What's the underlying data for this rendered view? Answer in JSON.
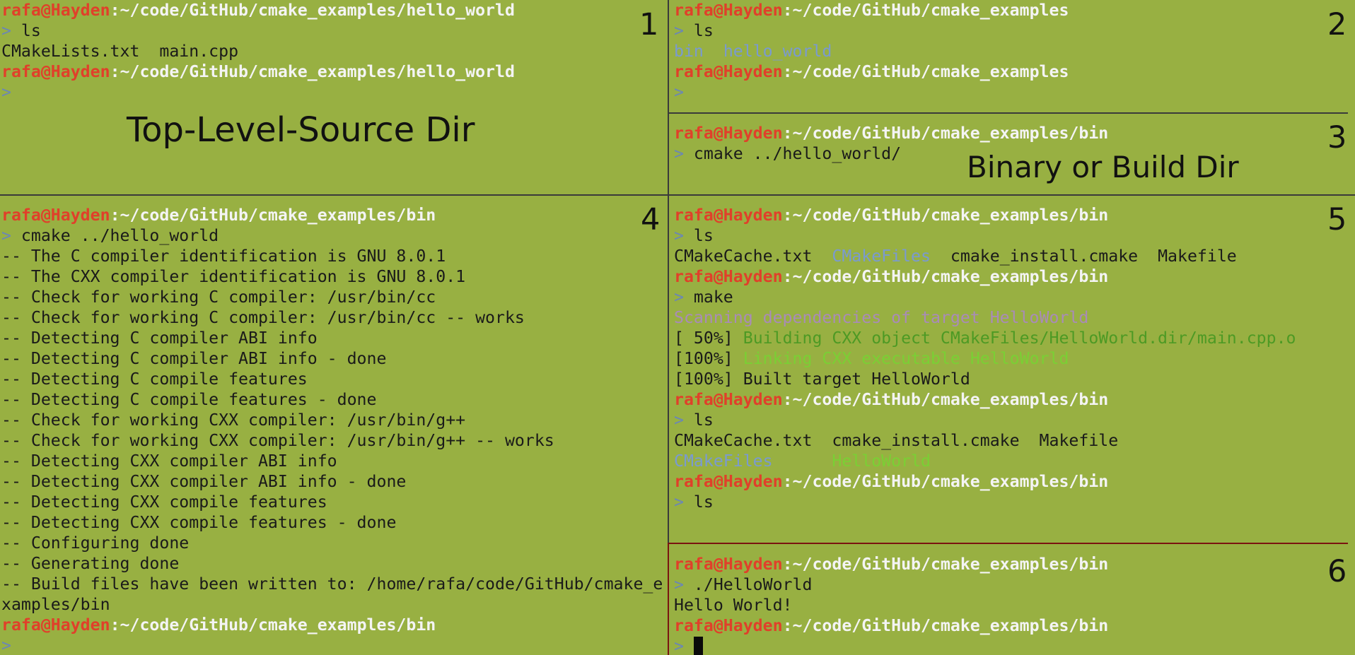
{
  "pane1": {
    "number": "1",
    "annotation": "Top-Level-Source Dir",
    "lines": [
      [
        {
          "t": "rafa@Hayden",
          "c": "u"
        },
        {
          "t": ":~/code/GitHub/cmake_examples/hello_world",
          "c": "p"
        }
      ],
      [
        {
          "t": "> ",
          "c": "pr"
        },
        {
          "t": "ls",
          "c": "o"
        }
      ],
      [
        {
          "t": "CMakeLists.txt  main.cpp",
          "c": "o"
        }
      ],
      [
        {
          "t": "rafa@Hayden",
          "c": "u"
        },
        {
          "t": ":~/code/GitHub/cmake_examples/hello_world",
          "c": "p"
        }
      ],
      [
        {
          "t": ">",
          "c": "pr"
        }
      ]
    ]
  },
  "pane2": {
    "number": "2",
    "lines": [
      [
        {
          "t": "rafa@Hayden",
          "c": "u"
        },
        {
          "t": ":~/code/GitHub/cmake_examples",
          "c": "p"
        }
      ],
      [
        {
          "t": "> ",
          "c": "pr"
        },
        {
          "t": "ls",
          "c": "o"
        }
      ],
      [
        {
          "t": "bin",
          "c": "dir"
        },
        {
          "t": "  ",
          "c": "o"
        },
        {
          "t": "hello_world",
          "c": "dir"
        }
      ],
      [
        {
          "t": "rafa@Hayden",
          "c": "u"
        },
        {
          "t": ":~/code/GitHub/cmake_examples",
          "c": "p"
        }
      ],
      [
        {
          "t": ">",
          "c": "pr"
        }
      ]
    ]
  },
  "pane3": {
    "number": "3",
    "annotation": "Binary or Build Dir",
    "lines": [
      [
        {
          "t": "rafa@Hayden",
          "c": "u"
        },
        {
          "t": ":~/code/GitHub/cmake_examples/bin",
          "c": "p"
        }
      ],
      [
        {
          "t": "> ",
          "c": "pr"
        },
        {
          "t": "cmake ../hello_world/",
          "c": "o"
        }
      ]
    ]
  },
  "pane4": {
    "number": "4",
    "lines": [
      [
        {
          "t": "rafa@Hayden",
          "c": "u"
        },
        {
          "t": ":~/code/GitHub/cmake_examples/bin",
          "c": "p"
        }
      ],
      [
        {
          "t": "> ",
          "c": "pr"
        },
        {
          "t": "cmake ../hello_world",
          "c": "o"
        }
      ],
      [
        {
          "t": "-- The C compiler identification is GNU 8.0.1",
          "c": "o"
        }
      ],
      [
        {
          "t": "-- The CXX compiler identification is GNU 8.0.1",
          "c": "o"
        }
      ],
      [
        {
          "t": "-- Check for working C compiler: /usr/bin/cc",
          "c": "o"
        }
      ],
      [
        {
          "t": "-- Check for working C compiler: /usr/bin/cc -- works",
          "c": "o"
        }
      ],
      [
        {
          "t": "-- Detecting C compiler ABI info",
          "c": "o"
        }
      ],
      [
        {
          "t": "-- Detecting C compiler ABI info - done",
          "c": "o"
        }
      ],
      [
        {
          "t": "-- Detecting C compile features",
          "c": "o"
        }
      ],
      [
        {
          "t": "-- Detecting C compile features - done",
          "c": "o"
        }
      ],
      [
        {
          "t": "-- Check for working CXX compiler: /usr/bin/g++",
          "c": "o"
        }
      ],
      [
        {
          "t": "-- Check for working CXX compiler: /usr/bin/g++ -- works",
          "c": "o"
        }
      ],
      [
        {
          "t": "-- Detecting CXX compiler ABI info",
          "c": "o"
        }
      ],
      [
        {
          "t": "-- Detecting CXX compiler ABI info - done",
          "c": "o"
        }
      ],
      [
        {
          "t": "-- Detecting CXX compile features",
          "c": "o"
        }
      ],
      [
        {
          "t": "-- Detecting CXX compile features - done",
          "c": "o"
        }
      ],
      [
        {
          "t": "-- Configuring done",
          "c": "o"
        }
      ],
      [
        {
          "t": "-- Generating done",
          "c": "o"
        }
      ],
      [
        {
          "t": "-- Build files have been written to: /home/rafa/code/GitHub/cmake_e",
          "c": "o"
        }
      ],
      [
        {
          "t": "xamples/bin",
          "c": "o"
        }
      ],
      [
        {
          "t": "rafa@Hayden",
          "c": "u"
        },
        {
          "t": ":~/code/GitHub/cmake_examples/bin",
          "c": "p"
        }
      ],
      [
        {
          "t": ">",
          "c": "pr"
        }
      ]
    ]
  },
  "pane5": {
    "number": "5",
    "lines": [
      [
        {
          "t": "rafa@Hayden",
          "c": "u"
        },
        {
          "t": ":~/code/GitHub/cmake_examples/bin",
          "c": "p"
        }
      ],
      [
        {
          "t": "> ",
          "c": "pr"
        },
        {
          "t": "ls",
          "c": "o"
        }
      ],
      [
        {
          "t": "CMakeCache.txt  ",
          "c": "o"
        },
        {
          "t": "CMakeFiles",
          "c": "dir"
        },
        {
          "t": "  cmake_install.cmake  Makefile",
          "c": "o"
        }
      ],
      [
        {
          "t": "rafa@Hayden",
          "c": "u"
        },
        {
          "t": ":~/code/GitHub/cmake_examples/bin",
          "c": "p"
        }
      ],
      [
        {
          "t": "> ",
          "c": "pr"
        },
        {
          "t": "make",
          "c": "o"
        }
      ],
      [
        {
          "t": "Scanning dependencies of target HelloWorld",
          "c": "mg"
        }
      ],
      [
        {
          "t": "[ 50%] ",
          "c": "o"
        },
        {
          "t": "Building CXX object CMakeFiles/HelloWorld.dir/main.cpp.o",
          "c": "gr"
        }
      ],
      [
        {
          "t": "[100%] ",
          "c": "o"
        },
        {
          "t": "Linking CXX executable HelloWorld",
          "c": "exe"
        }
      ],
      [
        {
          "t": "[100%] Built target HelloWorld",
          "c": "o"
        }
      ],
      [
        {
          "t": "rafa@Hayden",
          "c": "u"
        },
        {
          "t": ":~/code/GitHub/cmake_examples/bin",
          "c": "p"
        }
      ],
      [
        {
          "t": "> ",
          "c": "pr"
        },
        {
          "t": "ls",
          "c": "o"
        }
      ],
      [
        {
          "t": "CMakeCache.txt  cmake_install.cmake  Makefile",
          "c": "o"
        }
      ],
      [
        {
          "t": "CMakeFiles",
          "c": "dir"
        },
        {
          "t": "      ",
          "c": "o"
        },
        {
          "t": "HelloWorld",
          "c": "exe"
        }
      ],
      [
        {
          "t": "rafa@Hayden",
          "c": "u"
        },
        {
          "t": ":~/code/GitHub/cmake_examples/bin",
          "c": "p"
        }
      ],
      [
        {
          "t": "> ",
          "c": "pr"
        },
        {
          "t": "ls",
          "c": "o"
        }
      ]
    ]
  },
  "pane6": {
    "number": "6",
    "lines": [
      [
        {
          "t": "rafa@Hayden",
          "c": "u"
        },
        {
          "t": ":~/code/GitHub/cmake_examples/bin",
          "c": "p"
        }
      ],
      [
        {
          "t": "> ",
          "c": "pr"
        },
        {
          "t": "./HelloWorld",
          "c": "o"
        }
      ],
      [
        {
          "t": "Hello World!",
          "c": "o"
        }
      ],
      [
        {
          "t": "rafa@Hayden",
          "c": "u"
        },
        {
          "t": ":~/code/GitHub/cmake_examples/bin",
          "c": "p"
        }
      ],
      [
        {
          "t": "> ",
          "c": "pr"
        }
      ]
    ]
  }
}
